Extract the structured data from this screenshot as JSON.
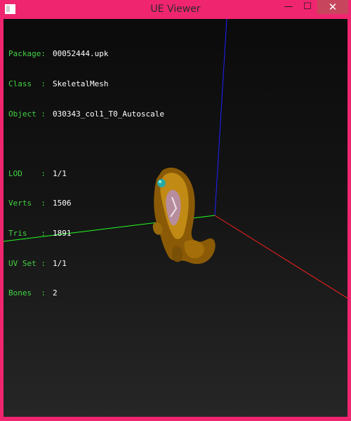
{
  "window": {
    "title": "UE Viewer"
  },
  "controls": {
    "minimize": "—",
    "maximize": "☐",
    "close": "✕"
  },
  "info": {
    "package": {
      "label": "Package:",
      "value": "00052444.upk"
    },
    "class": {
      "label": "Class  :",
      "value": "SkeletalMesh"
    },
    "object": {
      "label": "Object :",
      "value": "030343_col1_T0_Autoscale"
    },
    "lod": {
      "label": "LOD    :",
      "value": "1/1"
    },
    "verts": {
      "label": "Verts  :",
      "value": "1506"
    },
    "tris": {
      "label": "Tris   :",
      "value": "1891"
    },
    "uvset": {
      "label": "UV Set :",
      "value": "1/1"
    },
    "bones": {
      "label": "Bones  :",
      "value": "2"
    }
  },
  "colors": {
    "frame": "#f0256f",
    "label_text": "#42d442",
    "value_text": "#ffffff",
    "axis_x": "#ff2020",
    "axis_y": "#22ff22",
    "axis_z": "#2020ff",
    "mesh_gold": "#b8860b",
    "mesh_gem": "#2aa7a0"
  }
}
